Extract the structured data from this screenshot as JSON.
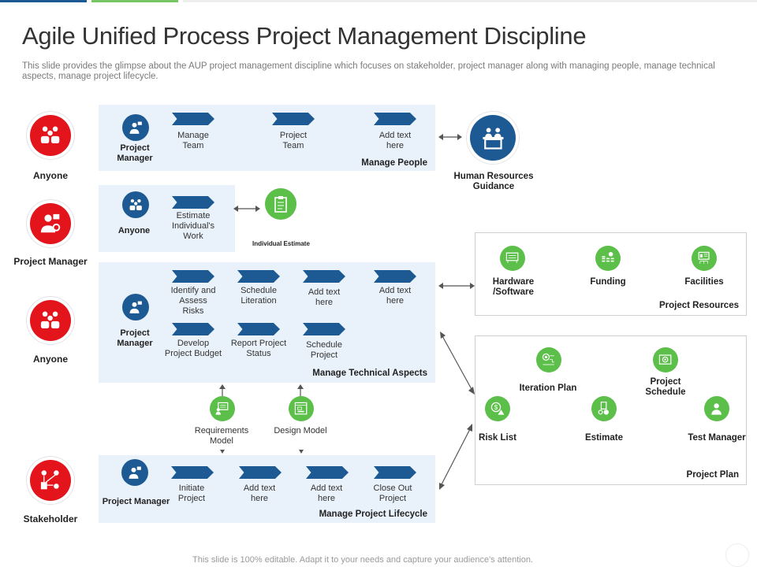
{
  "title": "Agile Unified Process Project Management Discipline",
  "subtitle": "This slide provides the glimpse about the AUP project management discipline which focuses on stakeholder, project manager along with managing people, manage technical aspects, manage project lifecycle.",
  "colors": {
    "accent_blue": "#1d5a93",
    "accent_green": "#5cbf4a",
    "accent_red": "#e3141b",
    "panel_bg": "#e9f2fa"
  },
  "left_roles": [
    {
      "label": "Anyone",
      "icon": "team-icon"
    },
    {
      "label": "Project Manager",
      "icon": "manager-icon"
    },
    {
      "label": "Anyone",
      "icon": "team-icon"
    },
    {
      "label": "Stakeholder",
      "icon": "stakeholder-network-icon"
    }
  ],
  "manage_people": {
    "title": "Manage People",
    "role": "Project Manager",
    "steps": [
      "Manage Team",
      "Project Team",
      "Add text here"
    ]
  },
  "estimate": {
    "role": "Anyone",
    "steps": [
      "Estimate Individual's Work"
    ],
    "artifact": "Individual Estimate"
  },
  "manage_technical": {
    "title": "Manage Technical Aspects",
    "role": "Project Manager",
    "row1": [
      "Identify and Assess Risks",
      "Schedule Literation",
      "Add text here",
      "Add text here"
    ],
    "row2": [
      "Develop Project Budget",
      "Report Project Status",
      "Schedule Project"
    ]
  },
  "models": [
    "Requirements Model",
    "Design Model"
  ],
  "manage_lifecycle": {
    "title": "Manage Project Lifecycle",
    "role": "Project Manager",
    "steps": [
      "Initiate Project",
      "Add text here",
      "Add text here",
      "Close Out Project"
    ]
  },
  "hr_guidance": {
    "label": "Human Resources Guidance"
  },
  "project_resources": {
    "title": "Project Resources",
    "items": [
      "Hardware /Software",
      "Funding",
      "Facilities"
    ]
  },
  "project_plan": {
    "title": "Project Plan",
    "items": [
      "Iteration Plan",
      "Project Schedule",
      "Risk List",
      "Estimate",
      "Test Manager"
    ]
  },
  "footer": "This slide is 100% editable. Adapt it to your needs and capture your audience's attention."
}
